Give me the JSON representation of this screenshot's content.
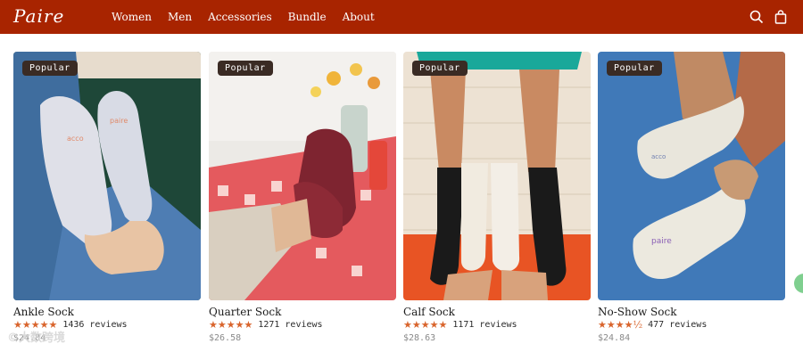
{
  "header": {
    "logo": "Paire",
    "nav": [
      "Women",
      "Men",
      "Accessories",
      "Bundle",
      "About"
    ],
    "bg_color": "#a82400",
    "icons": [
      "search-icon",
      "bag-icon"
    ]
  },
  "products": [
    {
      "name": "Ankle Sock",
      "badge": "Popular",
      "stars": "★★★★★",
      "reviews": "1436 reviews",
      "price": "$24.84"
    },
    {
      "name": "Quarter Sock",
      "badge": "Popular",
      "stars": "★★★★★",
      "reviews": "1271 reviews",
      "price": "$26.58"
    },
    {
      "name": "Calf Sock",
      "badge": "Popular",
      "stars": "★★★★★",
      "reviews": "1171 reviews",
      "price": "$28.63"
    },
    {
      "name": "No-Show Sock",
      "badge": "Popular",
      "stars": "★★★★½",
      "reviews": "477 reviews",
      "price": "$24.84"
    }
  ],
  "watermark": "©大数跨境",
  "accent_color": "#d9642c"
}
